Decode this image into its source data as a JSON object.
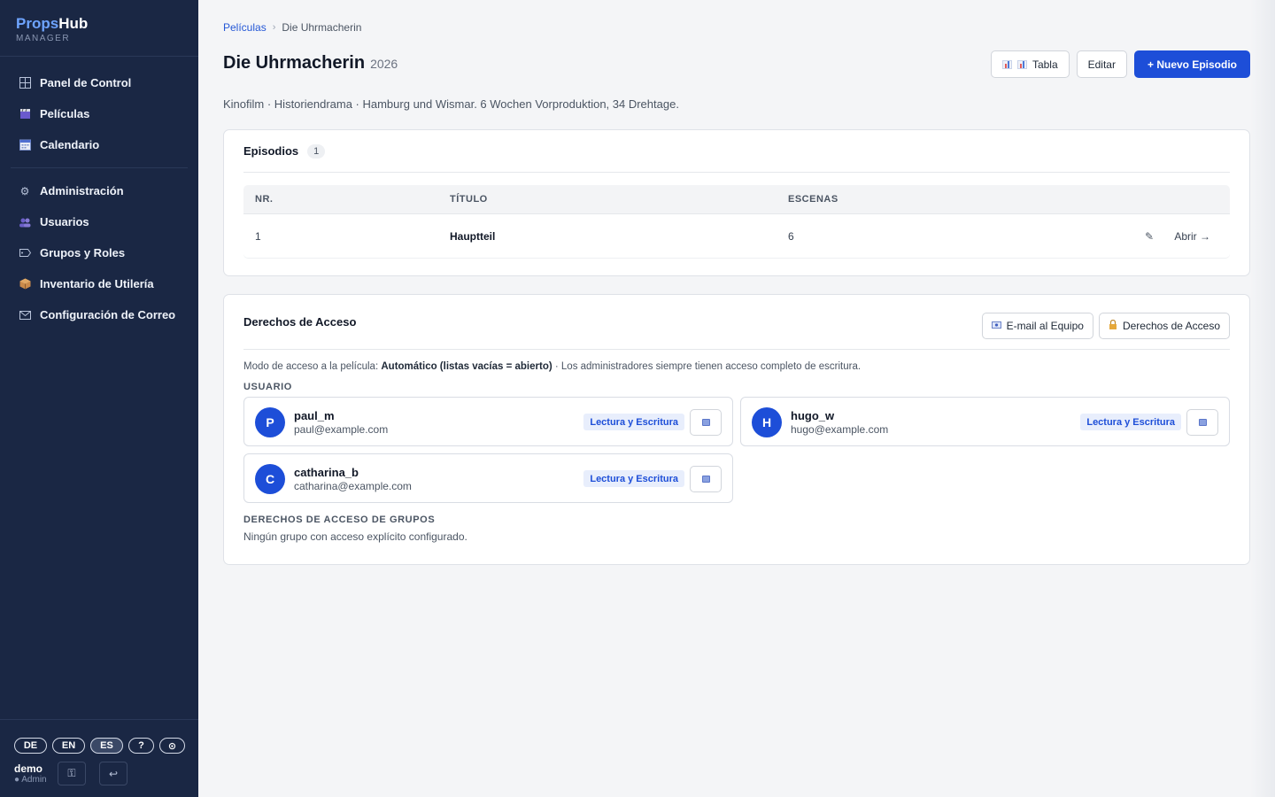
{
  "brand": {
    "part1": "Props",
    "part2": "Hub",
    "sub": "MANAGER"
  },
  "sidebar": {
    "items_top": [
      {
        "label": "Panel de Control",
        "icon": "grid-icon"
      },
      {
        "label": "Películas",
        "icon": "clapperboard-icon"
      },
      {
        "label": "Calendario",
        "icon": "calendar-icon"
      }
    ],
    "items_bottom": [
      {
        "label": "Administración",
        "icon": "gear-icon"
      },
      {
        "label": "Usuarios",
        "icon": "users-icon"
      },
      {
        "label": "Grupos y Roles",
        "icon": "tag-icon"
      },
      {
        "label": "Inventario de Utilería",
        "icon": "package-icon"
      },
      {
        "label": "Configuración de Correo",
        "icon": "mail-icon"
      }
    ],
    "languages": [
      "DE",
      "EN",
      "ES",
      "?",
      "⊙"
    ],
    "active_language": "ES",
    "user": {
      "name": "demo",
      "role": "● Admin"
    },
    "bottom_buttons": {
      "settings_icon": "⚿",
      "logout_icon": "↩"
    }
  },
  "breadcrumb": {
    "parent": "Películas",
    "separator": "›",
    "current": "Die Uhrmacherin"
  },
  "page": {
    "title": "Die Uhrmacherin",
    "year": "2026",
    "description": "Kinofilm · Historiendrama · Hamburg und Wismar. 6 Wochen Vorproduktion, 34 Drehtage."
  },
  "actions": {
    "table_label": "Tabla",
    "edit_label": "Editar",
    "new_episode_label": "+ Nuevo Episodio"
  },
  "episodes": {
    "title": "Episodios",
    "count": "1",
    "columns": [
      "NR.",
      "TÍTULO",
      "ESCENAS"
    ],
    "rows": [
      {
        "nr": "1",
        "title": "Hauptteil",
        "scenes": "6",
        "edit_icon": "✎",
        "open_label": "Abrir →"
      }
    ]
  },
  "access": {
    "title": "Derechos de Acceso",
    "email_team_label": "E-mail al Equipo",
    "access_rights_label": "Derechos de Acceso",
    "mode_prefix": "Modo de acceso a la película: ",
    "mode_value": "Automático (listas vacías = abierto)",
    "mode_suffix": " · Los administradores siempre tienen acceso completo de escritura.",
    "users_label": "USUARIO",
    "users": [
      {
        "initial": "P",
        "name": "paul_m",
        "email": "paul@example.com",
        "permission": "Lectura y Escritura"
      },
      {
        "initial": "H",
        "name": "hugo_w",
        "email": "hugo@example.com",
        "permission": "Lectura y Escritura"
      },
      {
        "initial": "C",
        "name": "catharina_b",
        "email": "catharina@example.com",
        "permission": "Lectura y Escritura"
      }
    ],
    "groups_label": "DERECHOS DE ACCESO DE GRUPOS",
    "groups_empty": "Ningún grupo con acceso explícito configurado."
  },
  "colors": {
    "sidebar_bg": "#1a2744",
    "accent": "#1d4ed8",
    "brand_accent": "#6ea4ff",
    "badge_bg": "#e8eefc"
  }
}
